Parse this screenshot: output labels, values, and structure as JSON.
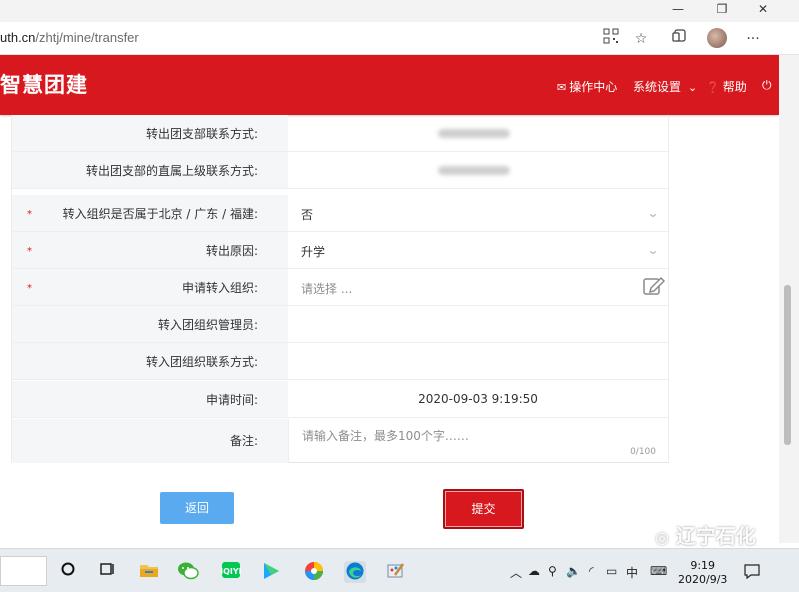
{
  "browser": {
    "url_host": "uth.cn",
    "url_path": "/zhtj/mine/transfer",
    "window_controls": [
      "—",
      "❐",
      "✕"
    ],
    "toolbar_icons": [
      "qr-icon",
      "star-icon",
      "collections-icon",
      "avatar",
      "more-icon"
    ],
    "more_label": "···"
  },
  "header": {
    "brand": "智慧团建",
    "nav": [
      {
        "icon": "mail-icon",
        "label": "操作中心"
      },
      {
        "icon": "chevron-down-icon",
        "label": "系统设置"
      },
      {
        "icon": "help-icon",
        "label": "帮助"
      }
    ],
    "accent_color": "#d7191f"
  },
  "form": {
    "rows": [
      {
        "label": "转出团支部联系方式:",
        "required": false,
        "value": "",
        "kind": "blurred"
      },
      {
        "label": "转出团支部的直属上级联系方式:",
        "required": false,
        "value": "",
        "kind": "blurred"
      },
      {
        "label": "转入组织是否属于北京 / 广东 / 福建:",
        "required": true,
        "value": "否",
        "kind": "select"
      },
      {
        "label": "转出原因:",
        "required": true,
        "value": "升学",
        "kind": "select"
      },
      {
        "label": "申请转入组织:",
        "required": true,
        "placeholder": "请选择 ...",
        "kind": "picker"
      },
      {
        "label": "转入团组织管理员:",
        "required": false,
        "value": "",
        "kind": "text"
      },
      {
        "label": "转入团组织联系方式:",
        "required": false,
        "value": "",
        "kind": "text"
      },
      {
        "label": "申请时间:",
        "required": false,
        "value": "2020-09-03 9:19:50",
        "kind": "readonly"
      },
      {
        "label": "备注:",
        "required": false,
        "placeholder": "请输入备注，最多100个字……",
        "counter": "0/100",
        "kind": "textarea"
      }
    ],
    "required_mark": "*"
  },
  "actions": {
    "back_label": "返回",
    "submit_label": "提交"
  },
  "taskbar": {
    "ime_label": "中",
    "time": "9:19",
    "date": "2020/9/3"
  },
  "watermark": {
    "text": "辽宁石化"
  }
}
